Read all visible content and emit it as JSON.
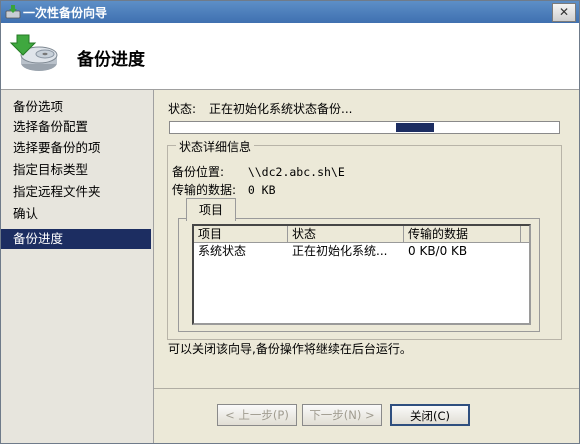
{
  "window": {
    "title": "一次性备份向导",
    "close": "✕"
  },
  "header": {
    "title": "备份进度"
  },
  "nav": {
    "items": [
      {
        "label": "备份选项"
      },
      {
        "label": "选择备份配置"
      },
      {
        "label": "选择要备份的项"
      },
      {
        "label": "指定目标类型"
      },
      {
        "label": "指定远程文件夹"
      },
      {
        "label": "确认"
      },
      {
        "label": "备份进度"
      }
    ],
    "selected_index": 6
  },
  "status": {
    "label": "状态:",
    "text": "正在初始化系统状态备份..."
  },
  "details": {
    "legend": "状态详细信息",
    "location_label": "备份位置:",
    "location_value": "\\\\dc2.abc.sh\\E",
    "transferred_label": "传输的数据:",
    "transferred_value": "0 KB"
  },
  "tabs": [
    {
      "label": "项目"
    }
  ],
  "table": {
    "headers": [
      "项目",
      "状态",
      "传输的数据"
    ],
    "rows": [
      [
        "系统状态",
        "正在初始化系统...",
        "0 KB/0 KB"
      ]
    ]
  },
  "note": "可以关闭该向导,备份操作将继续在后台运行。",
  "buttons": {
    "prev": "< 上一步(P)",
    "next": "下一步(N) >",
    "close": "关闭(C)"
  },
  "colors": {
    "selected_nav": "#1c2d61",
    "title_bar": "#3f70b0"
  }
}
